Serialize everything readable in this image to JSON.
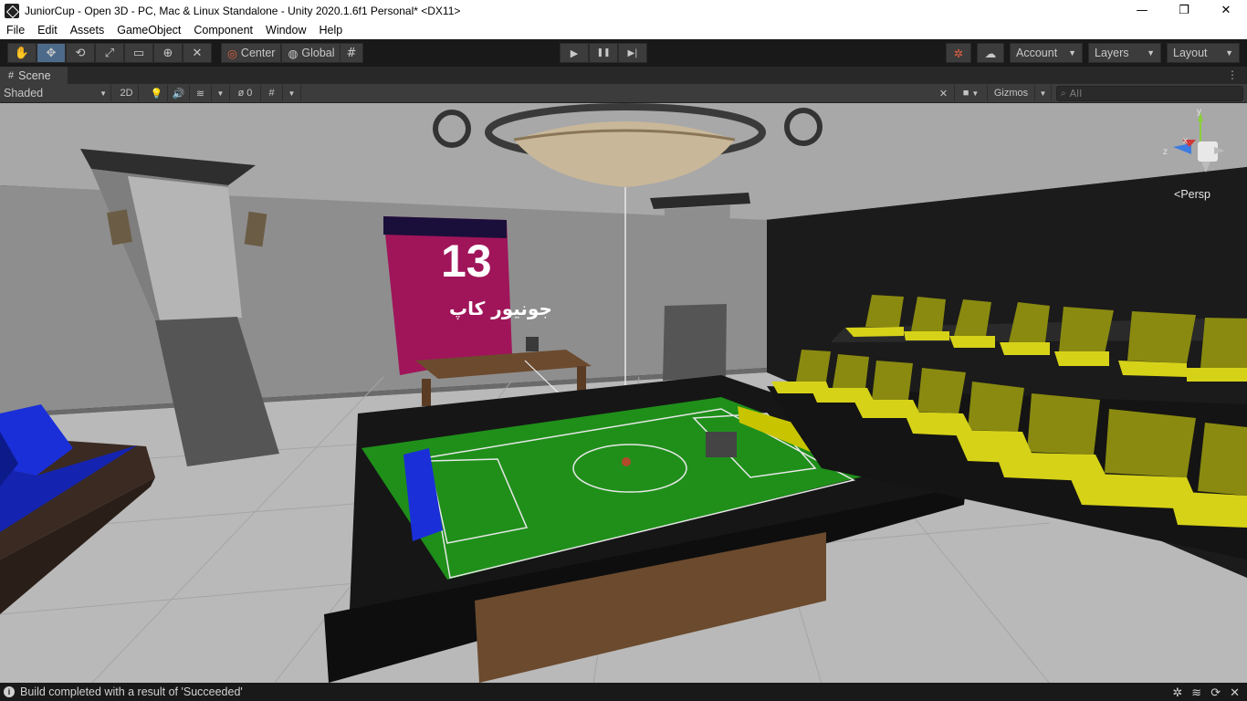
{
  "window": {
    "title": "JuniorCup - Open 3D - PC, Mac & Linux Standalone - Unity 2020.1.6f1 Personal* <DX11>",
    "minimize": "—",
    "maximize": "❐",
    "close": "✕"
  },
  "menu": [
    "File",
    "Edit",
    "Assets",
    "GameObject",
    "Component",
    "Window",
    "Help"
  ],
  "toolbar": {
    "tools": [
      {
        "name": "hand-tool",
        "glyph": "✋"
      },
      {
        "name": "move-tool",
        "glyph": "✥"
      },
      {
        "name": "rotate-tool",
        "glyph": "⟲"
      },
      {
        "name": "scale-tool",
        "glyph": "⤢"
      },
      {
        "name": "rect-tool",
        "glyph": "▭"
      },
      {
        "name": "transform-tool",
        "glyph": "⊕"
      },
      {
        "name": "custom-tool",
        "glyph": "✕"
      }
    ],
    "pivot_label": "Center",
    "space_label": "Global",
    "play": "▶",
    "pause": "❚❚",
    "step": "▶|",
    "account_label": "Account",
    "layers_label": "Layers",
    "layout_label": "Layout"
  },
  "scene_tab": {
    "label": "Scene"
  },
  "scene_toolbar": {
    "shading_mode": "Shaded",
    "mode_2d": "2D",
    "hidden_count": "0",
    "gizmos_label": "Gizmos",
    "search_placeholder": "All"
  },
  "viewport": {
    "projection_label": "Persp",
    "axis_x": "x",
    "axis_y": "y",
    "axis_z": "z",
    "poster_number": "13",
    "poster_title": "جونیور کاپ"
  },
  "status": {
    "message": "Build completed with a result of 'Succeeded'"
  },
  "colors": {
    "field_green": "#1f8f1a",
    "seat_yellow": "#c8c400",
    "sofa_blue": "#1a2fd8",
    "poster_magenta": "#a0155a"
  }
}
